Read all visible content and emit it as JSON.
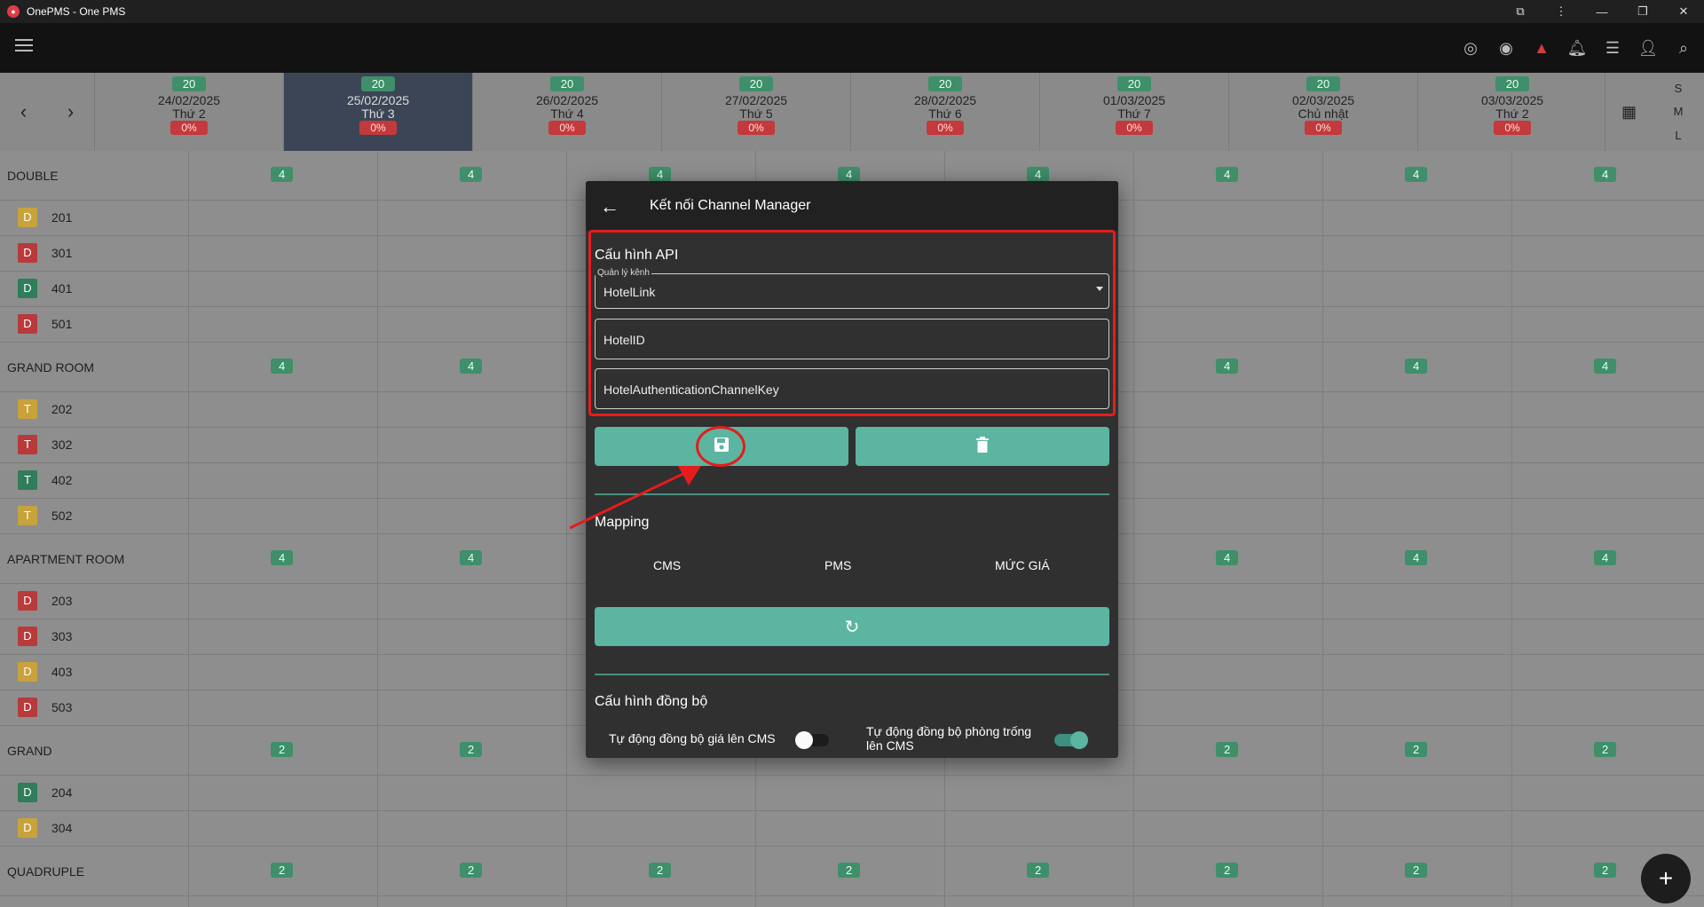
{
  "window": {
    "title": "OnePMS - One PMS"
  },
  "header": {
    "icons": [
      "sync-icon",
      "eye-icon",
      "warning-icon",
      "bell-icon",
      "list-icon",
      "add-user-icon",
      "search-icon"
    ]
  },
  "dates": [
    {
      "count": "20",
      "date": "24/02/2025",
      "weekday": "Thứ 2",
      "pct": "0%"
    },
    {
      "count": "20",
      "date": "25/02/2025",
      "weekday": "Thứ 3",
      "pct": "0%"
    },
    {
      "count": "20",
      "date": "26/02/2025",
      "weekday": "Thứ 4",
      "pct": "0%"
    },
    {
      "count": "20",
      "date": "27/02/2025",
      "weekday": "Thứ 5",
      "pct": "0%"
    },
    {
      "count": "20",
      "date": "28/02/2025",
      "weekday": "Thứ 6",
      "pct": "0%"
    },
    {
      "count": "20",
      "date": "01/03/2025",
      "weekday": "Thứ 7",
      "pct": "0%"
    },
    {
      "count": "20",
      "date": "02/03/2025",
      "weekday": "Chủ nhật",
      "pct": "0%"
    },
    {
      "count": "20",
      "date": "03/03/2025",
      "weekday": "Thứ 2",
      "pct": "0%"
    }
  ],
  "sizes": [
    "S",
    "M",
    "L"
  ],
  "categories": [
    {
      "name": "DOUBLE",
      "avail": "4",
      "rooms": [
        {
          "code": "D",
          "num": "201",
          "color": "#c9a23b"
        },
        {
          "code": "D",
          "num": "301",
          "color": "#b83a3a"
        },
        {
          "code": "D",
          "num": "401",
          "color": "#2f7d5a"
        },
        {
          "code": "D",
          "num": "501",
          "color": "#b83a3a"
        }
      ]
    },
    {
      "name": "GRAND ROOM",
      "avail": "4",
      "rooms": [
        {
          "code": "T",
          "num": "202",
          "color": "#c9a23b"
        },
        {
          "code": "T",
          "num": "302",
          "color": "#b83a3a"
        },
        {
          "code": "T",
          "num": "402",
          "color": "#2f7d5a"
        },
        {
          "code": "T",
          "num": "502",
          "color": "#c9a23b"
        }
      ]
    },
    {
      "name": "APARTMENT ROOM",
      "avail": "4",
      "rooms": [
        {
          "code": "D",
          "num": "203",
          "color": "#b83a3a"
        },
        {
          "code": "D",
          "num": "303",
          "color": "#b83a3a"
        },
        {
          "code": "D",
          "num": "403",
          "color": "#c9a23b"
        },
        {
          "code": "D",
          "num": "503",
          "color": "#b83a3a"
        }
      ]
    },
    {
      "name": "GRAND",
      "avail": "2",
      "rooms": [
        {
          "code": "D",
          "num": "204",
          "color": "#2f7d5a"
        },
        {
          "code": "D",
          "num": "304",
          "color": "#c9a23b"
        }
      ]
    },
    {
      "name": "QUADRUPLE",
      "avail": "2",
      "rooms": []
    }
  ],
  "modal": {
    "title": "Kết nối Channel Manager",
    "api_section": "Cấu hình API",
    "channel_legend": "Quản lý kênh",
    "channel_value": "HotelLink",
    "hotel_id_placeholder": "HotelID",
    "auth_key_placeholder": "HotelAuthenticationChannelKey",
    "mapping_title": "Mapping",
    "mapping_cols": [
      "CMS",
      "PMS",
      "MỨC GIÁ"
    ],
    "sync_section": "Cấu hình đồng bộ",
    "toggle_price_label": "Tự động đồng bộ giá lên CMS",
    "toggle_price_on": false,
    "toggle_room_label": "Tự động đồng bộ phòng trống lên CMS",
    "toggle_room_on": true
  },
  "colors": {
    "accent": "#5bb5a0",
    "annotation": "#e41c1c"
  }
}
